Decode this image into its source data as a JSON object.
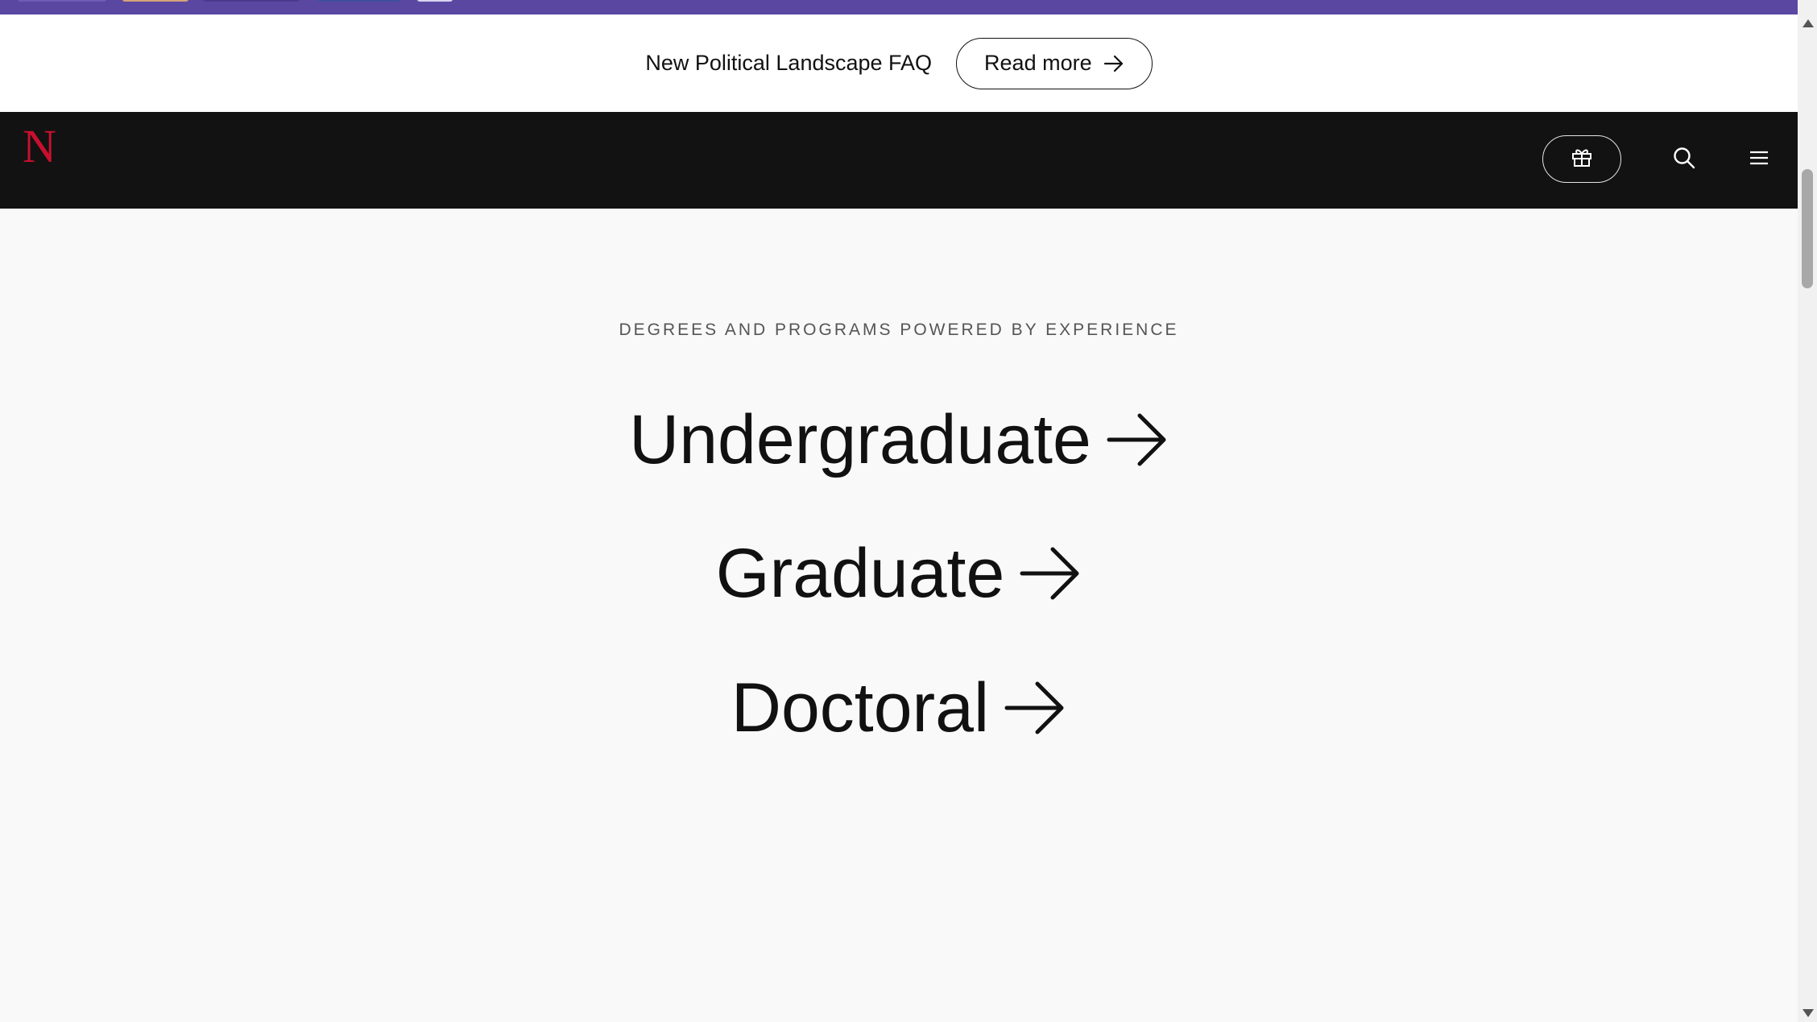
{
  "announcement": {
    "text": "New Political Landscape FAQ",
    "button_label": "Read more"
  },
  "navbar": {
    "logo_text": "N",
    "gift_icon": "gift-icon",
    "search_icon": "search-icon",
    "menu_icon": "menu-icon"
  },
  "main": {
    "eyebrow": "DEGREES AND PROGRAMS POWERED BY EXPERIENCE",
    "programs": [
      {
        "label": "Undergraduate"
      },
      {
        "label": "Graduate"
      },
      {
        "label": "Doctoral"
      }
    ]
  },
  "colors": {
    "brand_red": "#c8102e",
    "nav_bg": "#121212",
    "top_strip": "#5a47a2"
  }
}
